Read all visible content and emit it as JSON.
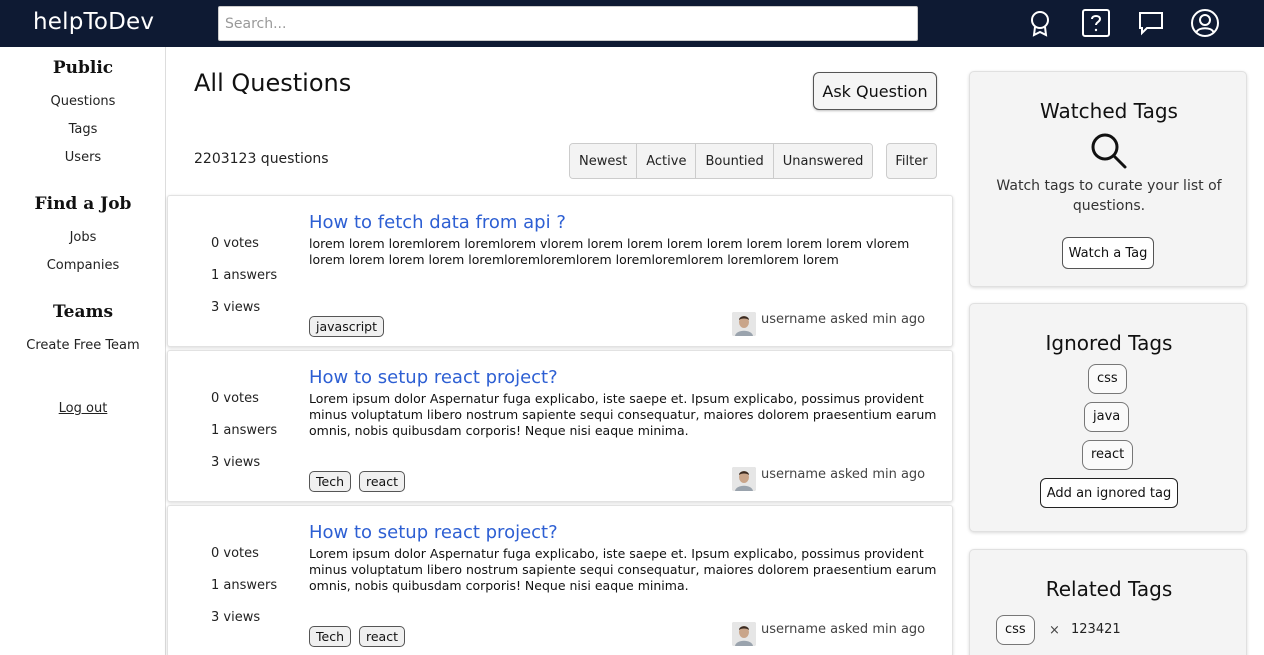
{
  "header": {
    "brand": "helpToDev",
    "search_placeholder": "Search...",
    "icons": [
      "achievements-icon",
      "help-icon",
      "inbox-icon",
      "profile-icon"
    ]
  },
  "sidebar": {
    "public_heading": "Public",
    "public_items": [
      "Questions",
      "Tags",
      "Users"
    ],
    "jobs_heading": "Find a Job",
    "jobs_items": [
      "Jobs",
      "Companies"
    ],
    "teams_heading": "Teams",
    "teams_items": [
      "Create Free Team"
    ],
    "logout": "Log out"
  },
  "main": {
    "title": "All Questions",
    "ask_button": "Ask Question",
    "count": "2203123 questions",
    "tabs": [
      "Newest",
      "Active",
      "Bountied",
      "Unanswered"
    ],
    "filter_button": "Filter",
    "questions": [
      {
        "votes": "0 votes",
        "answers": "1 answers",
        "views": "3 views",
        "title": "How to fetch data from api ?",
        "body": "lorem lorem loremlorem loremlorem vlorem lorem lorem lorem lorem lorem lorem lorem vlorem lorem lorem lorem lorem loremloremloremlorem loremloremlorem loremlorem lorem",
        "tags": [
          "javascript"
        ],
        "asked": "username asked min ago"
      },
      {
        "votes": "0 votes",
        "answers": "1 answers",
        "views": "3 views",
        "title": "How to setup react project?",
        "body": "Lorem ipsum dolor Aspernatur fuga explicabo, iste saepe et. Ipsum explicabo, possimus provident minus voluptatum libero nostrum sapiente sequi consequatur, maiores dolorem praesentium earum omnis, nobis quibusdam corporis! Neque nisi eaque minima.",
        "tags": [
          "Tech",
          "react"
        ],
        "asked": "username asked min ago"
      },
      {
        "votes": "0 votes",
        "answers": "1 answers",
        "views": "3 views",
        "title": "How to setup react project?",
        "body": "Lorem ipsum dolor Aspernatur fuga explicabo, iste saepe et. Ipsum explicabo, possimus provident minus voluptatum libero nostrum sapiente sequi consequatur, maiores dolorem praesentium earum omnis, nobis quibusdam corporis! Neque nisi eaque minima.",
        "tags": [
          "Tech",
          "react"
        ],
        "asked": "username asked min ago"
      }
    ]
  },
  "right": {
    "watched": {
      "title": "Watched Tags",
      "text": "Watch tags to curate your list of questions.",
      "button": "Watch a Tag"
    },
    "ignored": {
      "title": "Ignored Tags",
      "tags": [
        "css",
        "java",
        "react"
      ],
      "button": "Add an ignored tag"
    },
    "related": {
      "title": "Related Tags",
      "tag": "css",
      "times": "×",
      "count": "123421"
    }
  }
}
